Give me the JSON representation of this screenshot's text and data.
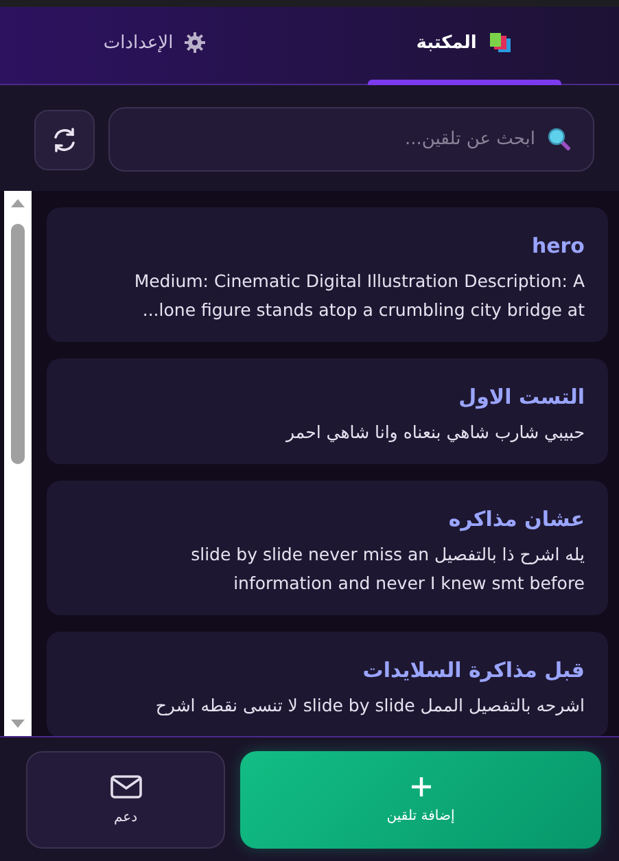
{
  "tabs": [
    {
      "label": "المكتبة",
      "selected": true
    },
    {
      "label": "الإعدادات",
      "selected": false
    }
  ],
  "search": {
    "placeholder": "ابحث عن تلقين..."
  },
  "prompts": [
    {
      "title": "hero",
      "description": "Medium: Cinematic Digital Illustration Description: A lone figure stands atop a crumbling city bridge at..."
    },
    {
      "title": "التست الاول",
      "description": "حبيبي شارب شاهي بنعناه وانا شاهي احمر"
    },
    {
      "title": "عشان مذاكره",
      "description": "يله اشرح ذا بالتفصيل slide by slide never miss an information and never I knew smt before"
    },
    {
      "title": "قبل مذاكرة السلايدات",
      "description": "اشرحه بالتفصيل الممل slide by slide لا تنسى نقطه اشرح"
    }
  ],
  "actions": [
    {
      "label": "إضافة تلقين",
      "kind": "primary"
    },
    {
      "label": "دعم",
      "kind": "secondary"
    }
  ]
}
